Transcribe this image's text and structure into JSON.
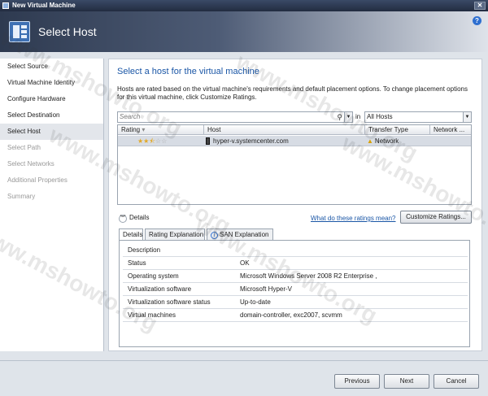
{
  "window": {
    "title": "New Virtual Machine"
  },
  "header": {
    "title": "Select Host",
    "help_glyph": "?"
  },
  "nav": {
    "items": [
      {
        "label": "Select Source",
        "state": "normal"
      },
      {
        "label": "Virtual Machine Identity",
        "state": "normal"
      },
      {
        "label": "Configure Hardware",
        "state": "normal"
      },
      {
        "label": "Select Destination",
        "state": "normal"
      },
      {
        "label": "Select Host",
        "state": "selected"
      },
      {
        "label": "Select Path",
        "state": "disabled"
      },
      {
        "label": "Select Networks",
        "state": "disabled"
      },
      {
        "label": "Additional Properties",
        "state": "disabled"
      },
      {
        "label": "Summary",
        "state": "disabled"
      }
    ]
  },
  "main": {
    "heading": "Select a host for the virtual machine",
    "description": "Hosts are rated based on the virtual machine's requirements and default placement options. To change placement options for this virtual machine, click Customize Ratings.",
    "search": {
      "placeholder": "Search",
      "in_label": "in",
      "scope": "All Hosts"
    },
    "grid": {
      "columns": [
        "Rating",
        "Host",
        "Transfer Type",
        "Network ..."
      ],
      "rows": [
        {
          "rating": 2.5,
          "host": "hyper-v.systemcenter.com",
          "transfer_type": "Network"
        }
      ]
    },
    "details_toggle": "Details",
    "ratings_link": "What do these ratings mean?",
    "customize_button": "Customize Ratings...",
    "tabs": [
      {
        "label": "Details",
        "active": true
      },
      {
        "label": "Rating Explanation",
        "active": false
      },
      {
        "label": "SAN Explanation",
        "active": false
      }
    ],
    "details": [
      {
        "key": "Description",
        "value": ""
      },
      {
        "key": "Status",
        "value": "OK"
      },
      {
        "key": "Operating system",
        "value": "Microsoft Windows Server 2008 R2 Enterprise ,"
      },
      {
        "key": "Virtualization software",
        "value": "Microsoft Hyper-V"
      },
      {
        "key": "Virtualization software status",
        "value": "Up-to-date"
      },
      {
        "key": "Virtual machines",
        "value": "domain-controller, exc2007, scvmm"
      }
    ]
  },
  "footer": {
    "previous": "Previous",
    "next": "Next",
    "cancel": "Cancel"
  },
  "watermark": "www.mshowto.org"
}
